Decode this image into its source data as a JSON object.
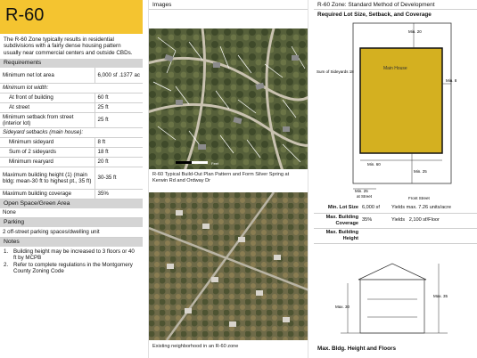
{
  "col1": {
    "title": "R-60",
    "intro": "The R-60 Zone typically results in residential subdivisions with a fairly dense housing pattern usually near commercial centers and outside CBDs.",
    "requirements_header": "Requirements",
    "rows": [
      {
        "label": "Minimum net lot area",
        "value": "6,000 sf .1377 ac"
      },
      {
        "label": "Minimum lot width:",
        "value": ""
      },
      {
        "label": "At front of building",
        "value": "60 ft"
      },
      {
        "label": "At street",
        "value": "25 ft"
      },
      {
        "label": "Minimum setback from street (interior lot)",
        "value": "25 ft"
      },
      {
        "label": "Sideyard setbacks (main house):",
        "value": ""
      },
      {
        "label": "Minimum sideyard",
        "value": "8 ft"
      },
      {
        "label": "Sum of 2 sideyards",
        "value": "18 ft"
      },
      {
        "label": "Minimum rearyard",
        "value": "20 ft"
      },
      {
        "label": "Maximum building height (1) (main bldg: mean-30 ft to highest pt., 35 ft)",
        "value": "30-35 ft"
      },
      {
        "label": "Maximum building coverage",
        "value": "35%"
      }
    ],
    "open_space_header": "Open Space/Green Area",
    "open_space_value": "None",
    "parking_header": "Parking",
    "parking_value": "2 off-street parking spaces/dwelling unit",
    "notes_header": "Notes",
    "notes": [
      {
        "n": "1.",
        "text": "Building height may be increased to 3 floors or 40 ft by MCPB"
      },
      {
        "n": "2.",
        "text": "Refer to complete regulations in the Montgomery County Zoning Code"
      }
    ]
  },
  "col2": {
    "header": "Images",
    "caption1": "R-60 Typical Build-Out Plan Pattern and Form Silver Spring at Kerwin Rd and Ordway Dr",
    "scale_label": "Feet",
    "caption2": "Existing neighborhood in an R-60 zone"
  },
  "col3": {
    "header": "R-60 Zone: Standard Method of Development",
    "sub1": "Required Lot Size, Setback, and Coverage",
    "diagram": {
      "main_house": "Main House",
      "min_rear": "Min. 20",
      "min_side": "Min. 8",
      "sum_sideyards": "Sum of Sideyards 18",
      "min_front_bldg": "Min. 60",
      "min_setback": "Min. 25",
      "min_street": "Min. 25",
      "at_street": "at Street",
      "front_street": "Front Street"
    },
    "table": [
      {
        "label": "Min. Lot Size",
        "v1": "6,000 sf",
        "v2": "Yields max. 7.26 units/acre"
      },
      {
        "label": "Max. Building Coverage",
        "v1": "35%",
        "v2": "Yields",
        "v3": "2,100 sf/Floor"
      },
      {
        "label": "Max. Building Height",
        "v1": "",
        "v2": ""
      }
    ],
    "height": {
      "max30": "Max. 30",
      "max35": "Max. 35"
    },
    "sub2": "Max. Bldg. Height and Floors",
    "colors": {
      "house": "#d4b020",
      "accent": "#f4c430"
    }
  }
}
